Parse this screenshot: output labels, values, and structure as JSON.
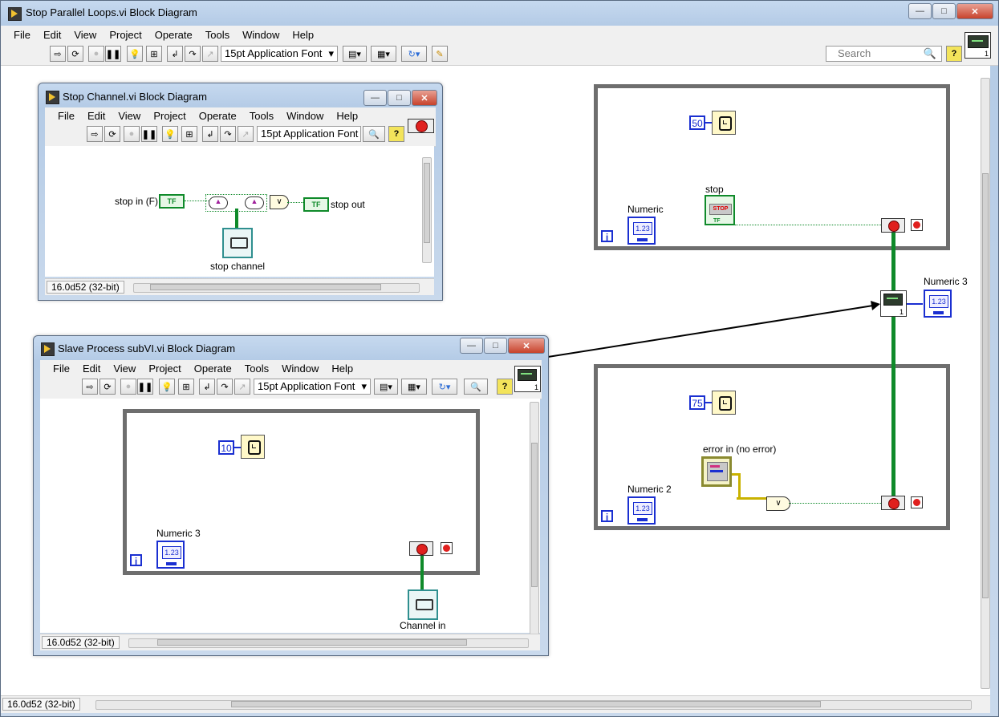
{
  "main": {
    "title": "Stop Parallel Loops.vi Block Diagram",
    "menu": [
      "File",
      "Edit",
      "View",
      "Project",
      "Operate",
      "Tools",
      "Window",
      "Help"
    ],
    "font": "15pt Application Font",
    "search_placeholder": "Search",
    "status": "16.0d52 (32-bit)"
  },
  "stop_channel": {
    "title": "Stop Channel.vi Block Diagram",
    "menu": [
      "File",
      "Edit",
      "View",
      "Project",
      "Operate",
      "Tools",
      "Window",
      "Help"
    ],
    "font": "15pt Application Font",
    "status": "16.0d52 (32-bit)",
    "stop_in_label": "stop in (F)",
    "stop_out_label": "stop out",
    "channel_label": "stop channel",
    "tf": "TF"
  },
  "slave": {
    "title": "Slave Process subVI.vi Block Diagram",
    "menu": [
      "File",
      "Edit",
      "View",
      "Project",
      "Operate",
      "Tools",
      "Window",
      "Help"
    ],
    "font": "15pt Application Font",
    "status": "16.0d52 (32-bit)",
    "wait_ms": "10",
    "numeric_label": "Numeric 3",
    "channel_label": "Channel in",
    "iter": "i",
    "num_text": "1.23"
  },
  "top_loop": {
    "wait_ms": "50",
    "stop_label": "stop",
    "stop_button_text": "STOP",
    "numeric_label": "Numeric",
    "iter": "i",
    "num_text": "1.23",
    "tf": "TF"
  },
  "bottom_loop": {
    "wait_ms": "75",
    "error_label": "error in (no error)",
    "numeric_label": "Numeric 2",
    "iter": "i",
    "num_text": "1.23"
  },
  "subvi_node": {
    "numeric_label": "Numeric 3",
    "num_text": "1.23",
    "conn_number": "1"
  },
  "colors": {
    "loop_border": "#6e6e6e",
    "numeric_blue": "#1a2fd1",
    "boolean_green": "#0f8a2a",
    "stop_red": "#e0201e"
  }
}
